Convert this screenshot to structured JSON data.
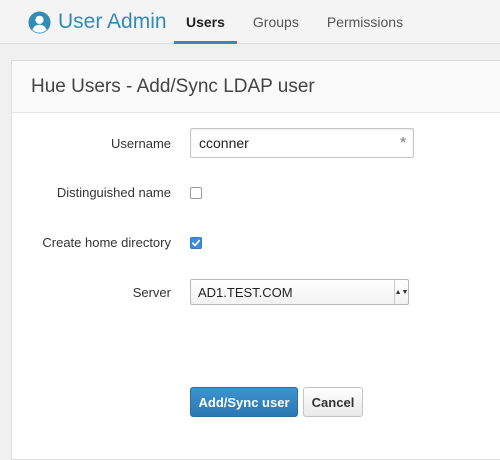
{
  "nav": {
    "brand": "User Admin",
    "brand_icon": "user-circle-icon",
    "accent_color": "#338bb8",
    "tabs": [
      {
        "label": "Users",
        "active": true
      },
      {
        "label": "Groups",
        "active": false
      },
      {
        "label": "Permissions",
        "active": false
      }
    ]
  },
  "page": {
    "title": "Hue Users - Add/Sync LDAP user"
  },
  "form": {
    "username_label": "Username",
    "username_value": "cconner",
    "required_marker": "*",
    "distinguished_label": "Distinguished name",
    "distinguished_checked": false,
    "home_dir_label": "Create home directory",
    "home_dir_checked": true,
    "server_label": "Server",
    "server_value": "AD1.TEST.COM"
  },
  "actions": {
    "submit_label": "Add/Sync user",
    "cancel_label": "Cancel"
  }
}
